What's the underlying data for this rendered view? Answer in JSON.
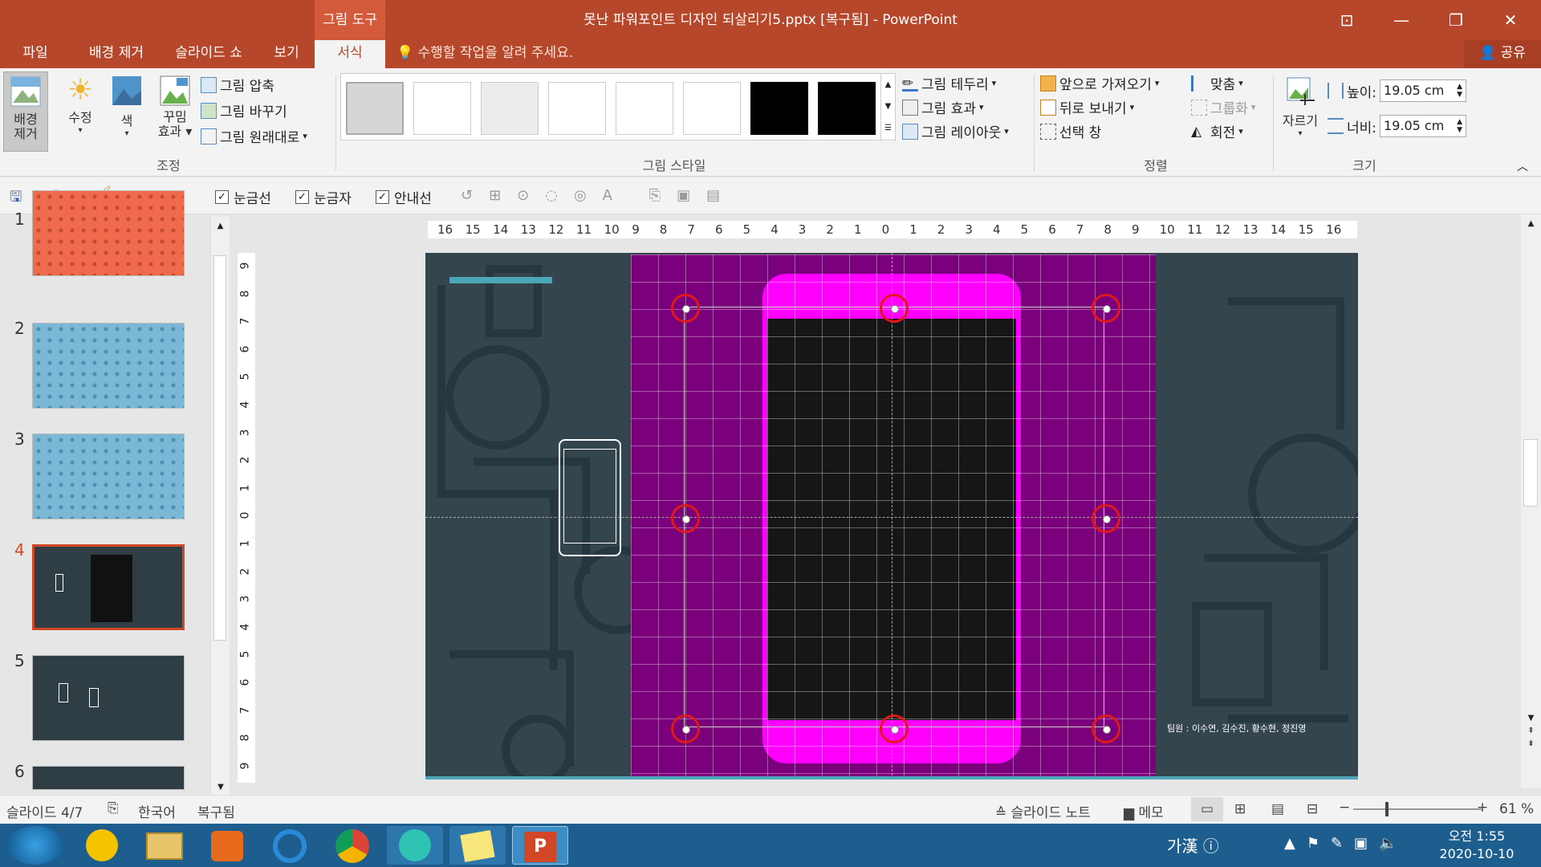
{
  "window": {
    "title": "못난 파워포인트 디자인 되살리기5.pptx [복구됨] - PowerPoint",
    "context_tab": "그림 도구"
  },
  "tabs": [
    "파일",
    "배경 제거",
    "슬라이드 쇼",
    "보기",
    "서식"
  ],
  "tell_me": "수행할 작업을 알려 주세요.",
  "share": "공유",
  "ribbon": {
    "remove_bg": [
      "배경",
      "제거"
    ],
    "correct": "수정",
    "color": "색",
    "artistic": [
      "꾸밈",
      "효과"
    ],
    "compress": "그림 압축",
    "change": "그림 바꾸기",
    "reset": "그림 원래대로",
    "adjust_group": "조정",
    "styles_group": "그림 스타일",
    "border": "그림 테두리",
    "effects": "그림 효과",
    "layout": "그림 레이아웃",
    "bring_forward": "앞으로 가져오기",
    "send_backward": "뒤로 보내기",
    "selection_pane": "선택 창",
    "align": "맞춤",
    "group": "그룹화",
    "rotate": "회전",
    "arrange_group": "정렬",
    "crop": "자르기",
    "height_label": "높이:",
    "height_value": "19.05 cm",
    "width_label": "너비:",
    "width_value": "19.05 cm",
    "size_group": "크기"
  },
  "qat": {
    "gridlines": "눈금선",
    "ruler": "눈금자",
    "guides": "안내선"
  },
  "slides": [
    {
      "n": "1"
    },
    {
      "n": "2"
    },
    {
      "n": "3"
    },
    {
      "n": "4"
    },
    {
      "n": "5"
    },
    {
      "n": "6"
    }
  ],
  "ruler_h": [
    "16",
    "15",
    "14",
    "13",
    "12",
    "11",
    "10",
    "9",
    "8",
    "7",
    "6",
    "5",
    "4",
    "3",
    "2",
    "1",
    "0",
    "1",
    "2",
    "3",
    "4",
    "5",
    "6",
    "7",
    "8",
    "9",
    "10",
    "11",
    "12",
    "13",
    "14",
    "15",
    "16"
  ],
  "ruler_v": [
    "9",
    "8",
    "7",
    "6",
    "5",
    "4",
    "3",
    "2",
    "1",
    "0",
    "1",
    "2",
    "3",
    "4",
    "5",
    "6",
    "7",
    "8",
    "9"
  ],
  "slide": {
    "team": "팀원 : 이수연, 김수진, 황수현, 정진영"
  },
  "status": {
    "slide": "슬라이드 4/7",
    "lang": "한국어",
    "recovered": "복구됨",
    "notes": "슬라이드 노트",
    "memo": "메모",
    "zoom": "61 %"
  },
  "tray": {
    "ime": "가漢",
    "time": "오전 1:55",
    "date": "2020-10-10"
  },
  "colors": {
    "accent": "#b7472a",
    "magenta": "#ff00ff",
    "purple": "#7b007b",
    "slide_bg": "#35454e"
  }
}
